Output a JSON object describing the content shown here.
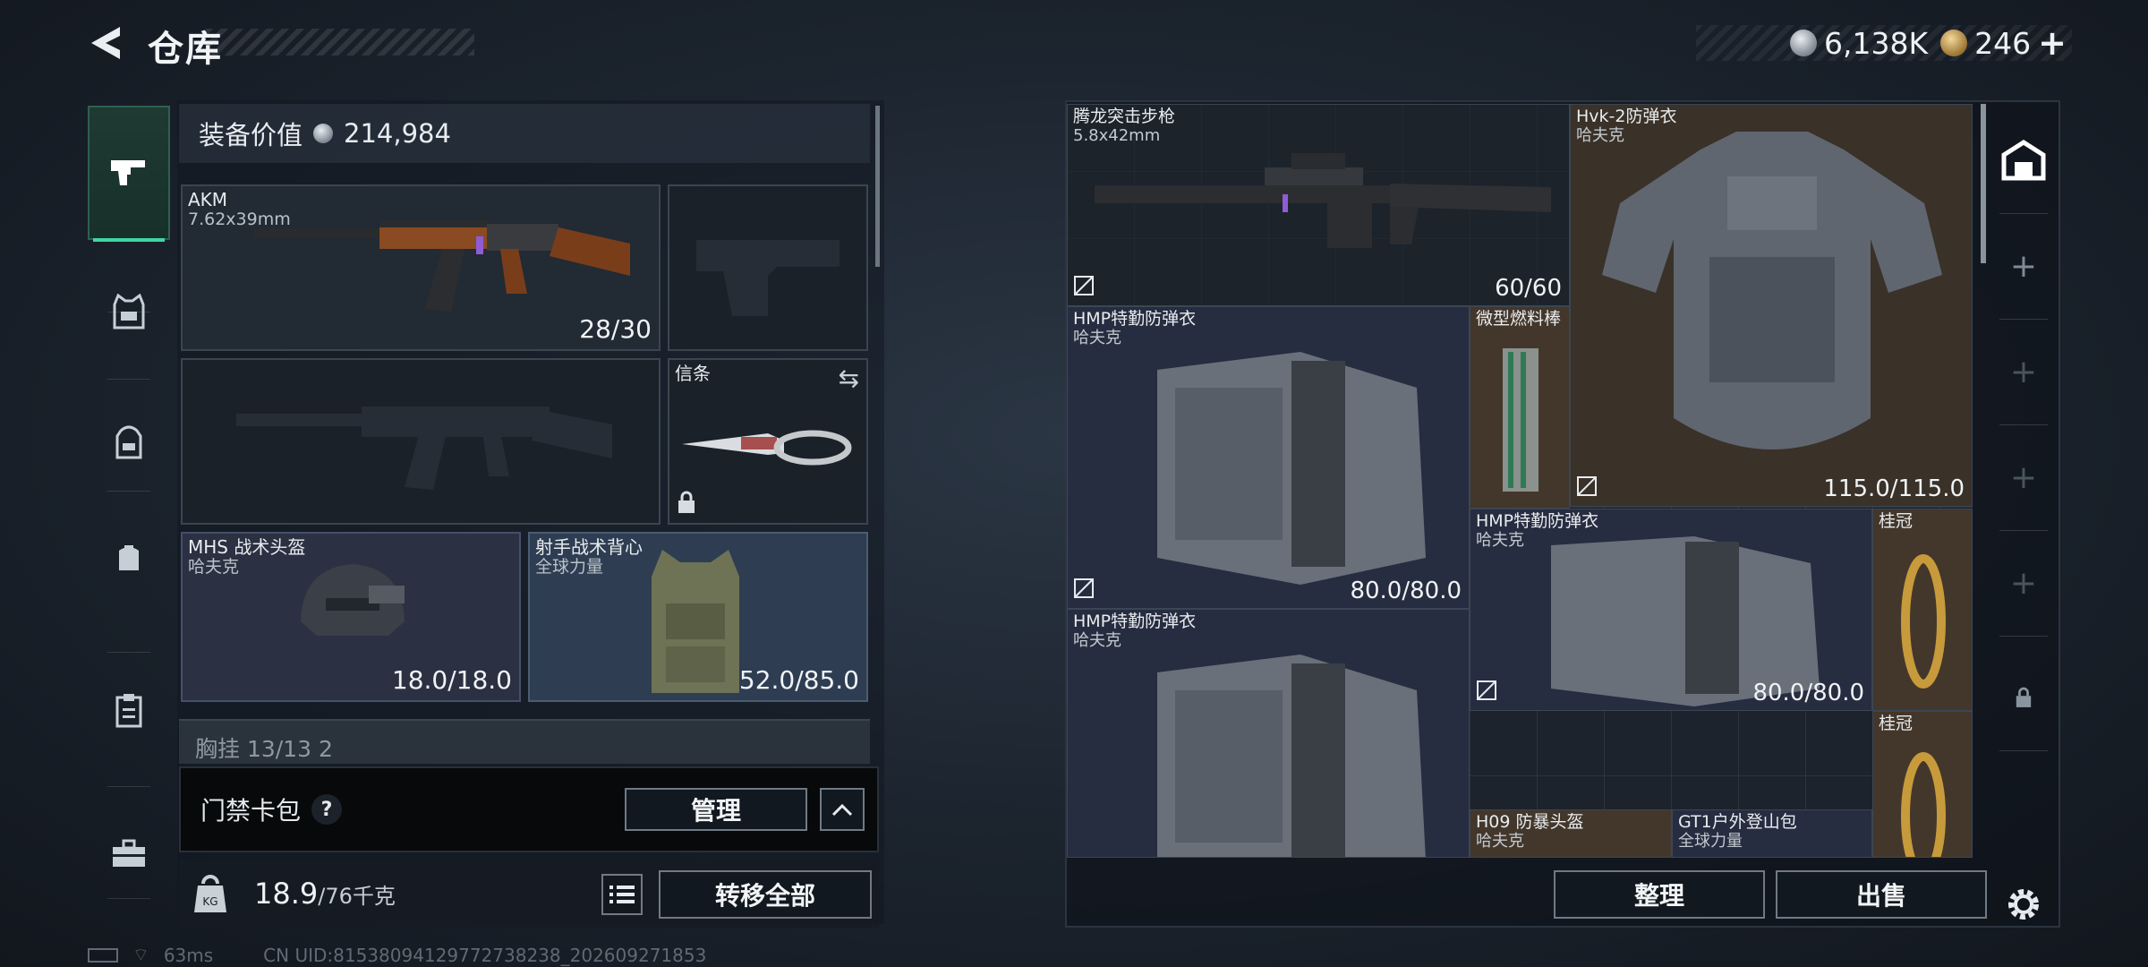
{
  "header": {
    "title": "仓库",
    "currencies": [
      {
        "icon": "silver-coin-icon",
        "value": "6,138K"
      },
      {
        "icon": "gold-coin-icon",
        "value": "246"
      }
    ]
  },
  "nav": {
    "items": [
      {
        "icon": "pistol-icon",
        "active": true
      },
      {
        "icon": "vest-icon",
        "active": false
      },
      {
        "icon": "backpack-icon",
        "active": false
      },
      {
        "icon": "pouch-icon",
        "active": false
      },
      {
        "icon": "clipboard-icon",
        "active": false
      },
      {
        "icon": "toolbox-icon",
        "active": false
      }
    ]
  },
  "loadout": {
    "equipment_value_label": "装备价值",
    "equipment_value": "214,984",
    "primary": {
      "name": "AKM",
      "caliber": "7.62x39mm",
      "ammo": "28/30"
    },
    "melee": {
      "name": "信条"
    },
    "helmet": {
      "name": "MHS 战术头盔",
      "brand": "哈夫克",
      "durability": "18.0/18.0"
    },
    "vest": {
      "name": "射手战术背心",
      "brand": "全球力量",
      "durability": "52.0/85.0"
    },
    "partial_row": "胸挂 13/13 2",
    "keycase_label": "门禁卡包",
    "keycase_help": "?",
    "manage_button": "管理",
    "weight_value": "18.9",
    "weight_max": "/76千克",
    "transfer_all_button": "转移全部"
  },
  "stash": {
    "items": [
      {
        "name": "腾龙突击步枪",
        "sub": "5.8x42mm",
        "value": "60/60"
      },
      {
        "name": "Hvk-2防弹衣",
        "sub": "哈夫克",
        "value": "115.0/115.0"
      },
      {
        "name": "HMP特勤防弹衣",
        "sub": "哈夫克",
        "value": "80.0/80.0"
      },
      {
        "name": "微型燃料棒",
        "sub": "",
        "value": ""
      },
      {
        "name": "HMP特勤防弹衣",
        "sub": "哈夫克",
        "value": "80.0/80.0"
      },
      {
        "name": "桂冠",
        "sub": "",
        "value": ""
      },
      {
        "name": "HMP特勤防弹衣",
        "sub": "哈夫克",
        "value": ""
      },
      {
        "name": "桂冠",
        "sub": "",
        "value": ""
      },
      {
        "name": "H09 防暴头盔",
        "sub": "哈夫克",
        "value": ""
      },
      {
        "name": "GT1户外登山包",
        "sub": "全球力量",
        "value": ""
      }
    ],
    "sort_button": "整理",
    "sell_button": "出售"
  },
  "status": {
    "ping": "63ms",
    "uid": "CN UID:8153809412977273823​8_202609271853"
  },
  "colors": {
    "accent": "#3fd6a1",
    "panel": "#222a34",
    "stash_navy": "#272d40",
    "stash_brown": "#3a3128"
  }
}
